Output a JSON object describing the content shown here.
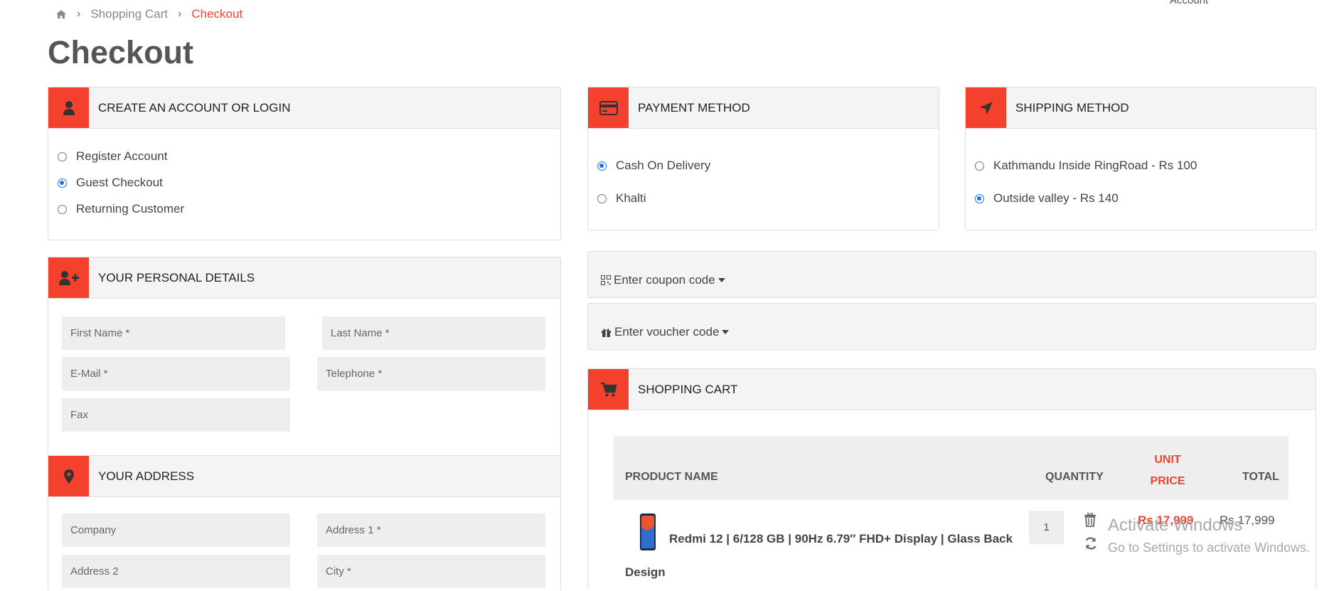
{
  "breadcrumb": {
    "cart": "Shopping Cart",
    "current": "Checkout"
  },
  "top_right": "Account",
  "page_title": "Checkout",
  "account": {
    "title": "CREATE AN ACCOUNT OR LOGIN",
    "options": [
      "Register Account",
      "Guest Checkout",
      "Returning Customer"
    ],
    "selected": "Guest Checkout"
  },
  "payment": {
    "title": "PAYMENT METHOD",
    "options": [
      "Cash On Delivery",
      "Khalti"
    ],
    "selected": "Cash On Delivery"
  },
  "shipping": {
    "title": "SHIPPING METHOD",
    "options": [
      "Kathmandu Inside RingRoad - Rs 100",
      "Outside valley - Rs 140"
    ],
    "selected": "Outside valley - Rs 140"
  },
  "personal": {
    "title": "YOUR PERSONAL DETAILS",
    "first_name": "First Name *",
    "last_name": "Last Name *",
    "email": "E-Mail *",
    "telephone": "Telephone *",
    "fax": "Fax"
  },
  "address": {
    "title": "YOUR ADDRESS",
    "company": "Company",
    "address1": "Address 1 *",
    "address2": "Address 2",
    "city": "City *"
  },
  "coupon": {
    "label": "Enter coupon code"
  },
  "voucher": {
    "label": "Enter voucher code"
  },
  "cart": {
    "title": "SHOPPING CART",
    "headers": {
      "product": "PRODUCT NAME",
      "quantity": "QUANTITY",
      "unit_price_1": "UNIT",
      "unit_price_2": "PRICE",
      "total": "TOTAL"
    },
    "item": {
      "name_line1": "Redmi 12 | 6/128 GB | 90Hz 6.79″ FHD+ Display | Glass Back",
      "name_line2": "Design",
      "quantity": "1",
      "unit_price": "Rs 17,999",
      "total": "Rs 17,999"
    }
  },
  "watermark": {
    "line1": "Activate Windows",
    "line2": "Go to Settings to activate Windows."
  },
  "colors": {
    "accent": "#f4412d",
    "radio": "#1a73e8"
  }
}
